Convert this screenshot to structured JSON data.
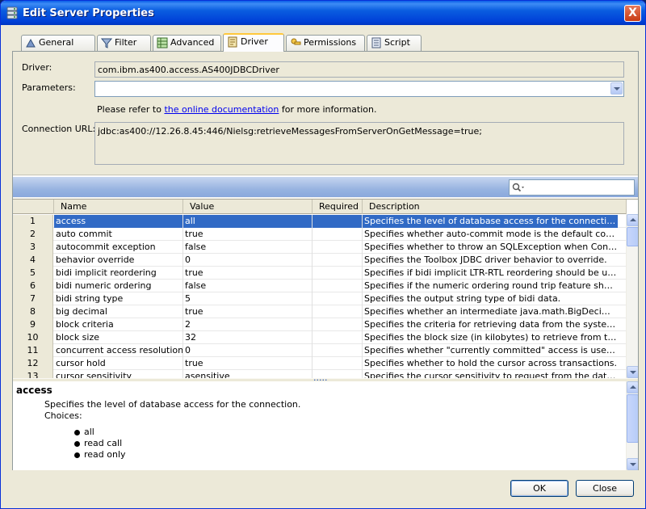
{
  "window": {
    "title": "Edit Server Properties",
    "close_glyph": "X"
  },
  "tabs": [
    {
      "label": "General",
      "icon": "general-tab-icon",
      "active": false
    },
    {
      "label": "Filter",
      "icon": "filter-tab-icon",
      "active": false
    },
    {
      "label": "Advanced",
      "icon": "advanced-tab-icon",
      "active": false
    },
    {
      "label": "Driver",
      "icon": "driver-tab-icon",
      "active": true
    },
    {
      "label": "Permissions",
      "icon": "permissions-tab-icon",
      "active": false
    },
    {
      "label": "Script",
      "icon": "script-tab-icon",
      "active": false
    }
  ],
  "driver": {
    "driver_label": "Driver:",
    "driver_value": "com.ibm.as400.access.AS400JDBCDriver",
    "parameters_label": "Parameters:",
    "parameters_value": "",
    "refer_prefix": "Please refer to ",
    "refer_link": "the online documentation",
    "refer_suffix": " for more information.",
    "url_label": "Connection URL:",
    "url_value": "jdbc:as400://12.26.8.45:446/Nielsg:retrieveMessagesFromServerOnGetMessage=true;"
  },
  "search": {
    "placeholder": "",
    "icon": "search-icon"
  },
  "grid": {
    "columns": [
      "Name",
      "Value",
      "Required",
      "Description"
    ],
    "rows": [
      {
        "num": "1",
        "name": "access",
        "value": "all",
        "required": "",
        "desc": "Specifies the level of database access for the connection."
      },
      {
        "num": "2",
        "name": "auto commit",
        "value": "true",
        "required": "",
        "desc": "Specifies whether auto-commit mode is the default connection mode for new connections."
      },
      {
        "num": "3",
        "name": "autocommit exception",
        "value": "false",
        "required": "",
        "desc": "Specifies whether to throw an SQLException when Connection.commit() is called in auto-commit mode."
      },
      {
        "num": "4",
        "name": "behavior override",
        "value": "0",
        "required": "",
        "desc": "Specifies the Toolbox JDBC driver behavior to override."
      },
      {
        "num": "5",
        "name": "bidi implicit reordering",
        "value": "true",
        "required": "",
        "desc": "Specifies if bidi implicit LTR-RTL reordering should be used."
      },
      {
        "num": "6",
        "name": "bidi numeric ordering",
        "value": "false",
        "required": "",
        "desc": "Specifies if the numeric ordering round trip feature should be used."
      },
      {
        "num": "7",
        "name": "bidi string type",
        "value": "5",
        "required": "",
        "desc": "Specifies the output string type of bidi data."
      },
      {
        "num": "8",
        "name": "big decimal",
        "value": "true",
        "required": "",
        "desc": "Specifies whether an intermediate java.math.BigDecimal object is used for conversions."
      },
      {
        "num": "9",
        "name": "block criteria",
        "value": "2",
        "required": "",
        "desc": "Specifies the criteria for retrieving data from the system in blocks of records."
      },
      {
        "num": "10",
        "name": "block size",
        "value": "32",
        "required": "",
        "desc": "Specifies the block size (in kilobytes) to retrieve from the system and cache on the client."
      },
      {
        "num": "11",
        "name": "concurrent access resolution",
        "value": "0",
        "required": "",
        "desc": "Specifies whether \"currently committed\" access is used on the connection."
      },
      {
        "num": "12",
        "name": "cursor hold",
        "value": "true",
        "required": "",
        "desc": "Specifies whether to hold the cursor across transactions."
      },
      {
        "num": "13",
        "name": "cursor sensitivity",
        "value": "asensitive",
        "required": "",
        "desc": "Specifies the cursor sensitivity to request from the database."
      }
    ]
  },
  "detail": {
    "title": "access",
    "text": "Specifies the level of database access for the connection.",
    "choices_label": "Choices:",
    "choices": [
      "all",
      "read call",
      "read only"
    ]
  },
  "buttons": {
    "ok": "OK",
    "close": "Close"
  }
}
